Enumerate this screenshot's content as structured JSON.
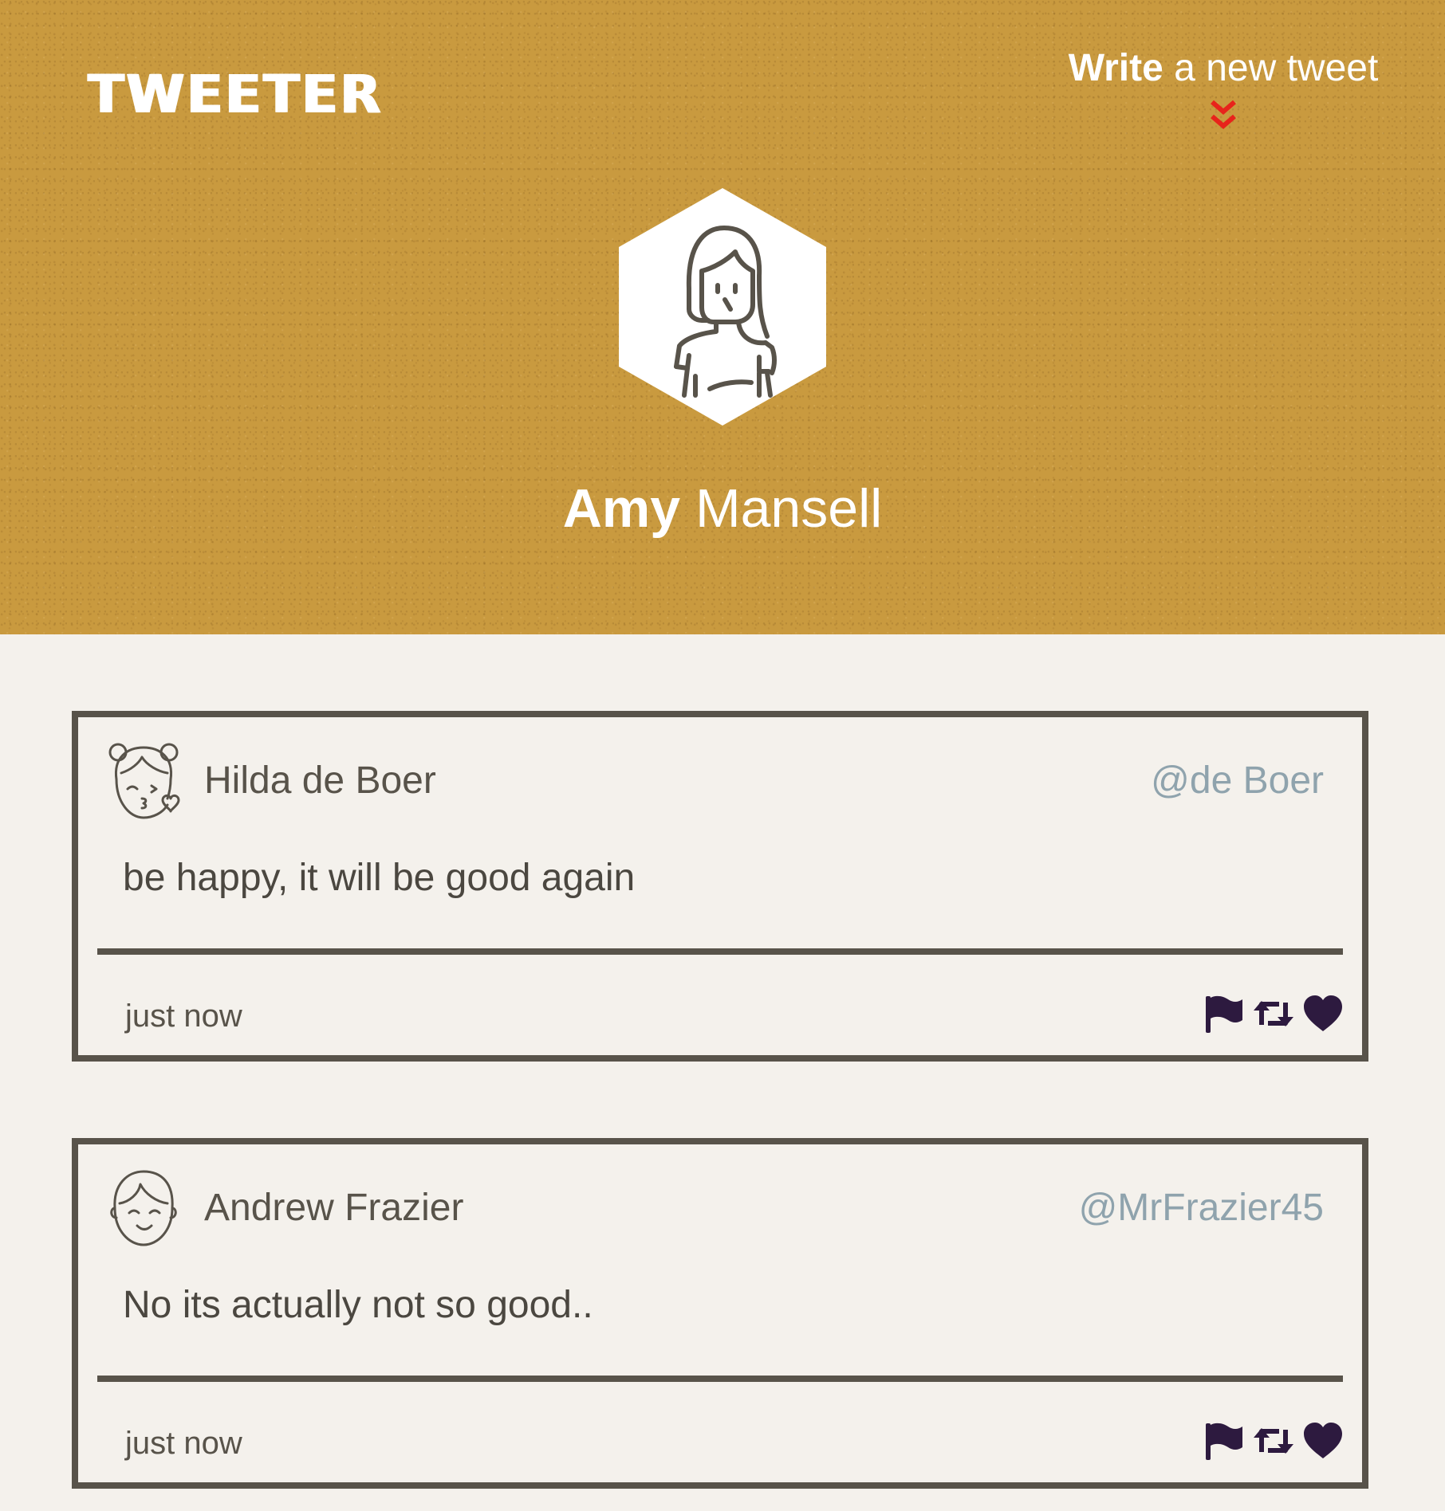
{
  "header": {
    "logo": "TWEETER",
    "compose": {
      "bold": "Write",
      "rest": " a new tweet",
      "arrow_icon": "double-chevron-down-icon",
      "arrow_color": "#e8231b"
    },
    "profile": {
      "first_name": "Amy",
      "last_name": " Mansell",
      "avatar_icon": "woman-avatar-icon"
    },
    "background_color": "#c99a3f"
  },
  "tweets": [
    {
      "avatar_icon": "girl-kiss-avatar-icon",
      "name": "Hilda de Boer",
      "handle": "@de Boer",
      "text": "be happy, it will be good again",
      "time": "just now",
      "actions": [
        "flag-icon",
        "retweet-icon",
        "heart-icon"
      ]
    },
    {
      "avatar_icon": "boy-smile-avatar-icon",
      "name": "Andrew Frazier",
      "handle": "@MrFrazier45",
      "text": "No its actually not so good..",
      "time": "just now",
      "actions": [
        "flag-icon",
        "retweet-icon",
        "heart-icon"
      ]
    }
  ],
  "colors": {
    "page_background": "#f4f1ec",
    "border": "#58534a",
    "handle": "#8fa3ad",
    "action_icons": "#2d1a3f"
  }
}
